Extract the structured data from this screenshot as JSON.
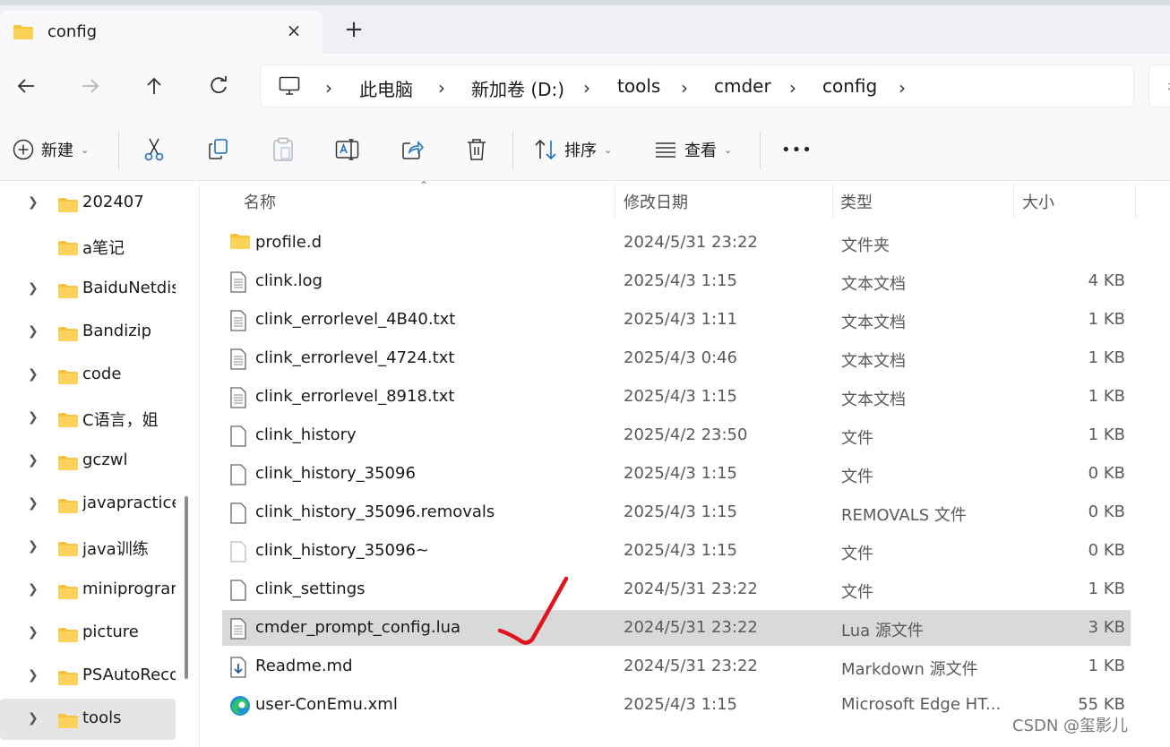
{
  "tab": {
    "title": "config",
    "close_icon": "×",
    "new_tab_icon": "+"
  },
  "breadcrumb": {
    "items": [
      "此电脑",
      "新加卷 (D:)",
      "tools",
      "cmder",
      "config"
    ],
    "separator": "›",
    "search_partial": "在"
  },
  "toolbar": {
    "new_label": "新建",
    "sort_label": "排序",
    "view_label": "查看",
    "more_label": "•••"
  },
  "sidebar": {
    "items": [
      {
        "label": "202407",
        "expandable": true
      },
      {
        "label": "a笔记",
        "expandable": false
      },
      {
        "label": "BaiduNetdisk",
        "expandable": true
      },
      {
        "label": "Bandizip",
        "expandable": true
      },
      {
        "label": "code",
        "expandable": true
      },
      {
        "label": "C语言，姐",
        "expandable": true
      },
      {
        "label": "gczwl",
        "expandable": true
      },
      {
        "label": "javapractice",
        "expandable": true
      },
      {
        "label": "java训练",
        "expandable": true
      },
      {
        "label": "miniprogram",
        "expandable": true
      },
      {
        "label": "picture",
        "expandable": true
      },
      {
        "label": "PSAutoRecover",
        "expandable": true
      },
      {
        "label": "tools",
        "expandable": true,
        "selected": true
      }
    ]
  },
  "columns": {
    "name": "名称",
    "date": "修改日期",
    "type": "类型",
    "size": "大小"
  },
  "files": [
    {
      "name": "profile.d",
      "date": "2024/5/31 23:22",
      "type": "文件夹",
      "size": "",
      "icon": "folder"
    },
    {
      "name": "clink.log",
      "date": "2025/4/3 1:15",
      "type": "文本文档",
      "size": "4 KB",
      "icon": "text"
    },
    {
      "name": "clink_errorlevel_4B40.txt",
      "date": "2025/4/3 1:11",
      "type": "文本文档",
      "size": "1 KB",
      "icon": "text"
    },
    {
      "name": "clink_errorlevel_4724.txt",
      "date": "2025/4/3 0:46",
      "type": "文本文档",
      "size": "1 KB",
      "icon": "text"
    },
    {
      "name": "clink_errorlevel_8918.txt",
      "date": "2025/4/3 1:15",
      "type": "文本文档",
      "size": "1 KB",
      "icon": "text"
    },
    {
      "name": "clink_history",
      "date": "2025/4/2 23:50",
      "type": "文件",
      "size": "1 KB",
      "icon": "file"
    },
    {
      "name": "clink_history_35096",
      "date": "2025/4/3 1:15",
      "type": "文件",
      "size": "0 KB",
      "icon": "file"
    },
    {
      "name": "clink_history_35096.removals",
      "date": "2025/4/3 1:15",
      "type": "REMOVALS 文件",
      "size": "0 KB",
      "icon": "file"
    },
    {
      "name": "clink_history_35096~",
      "date": "2025/4/3 1:15",
      "type": "文件",
      "size": "0 KB",
      "icon": "file-faded"
    },
    {
      "name": "clink_settings",
      "date": "2024/5/31 23:22",
      "type": "文件",
      "size": "1 KB",
      "icon": "file"
    },
    {
      "name": "cmder_prompt_config.lua",
      "date": "2024/5/31 23:22",
      "type": "Lua 源文件",
      "size": "3 KB",
      "icon": "text",
      "selected": true
    },
    {
      "name": "Readme.md",
      "date": "2024/5/31 23:22",
      "type": "Markdown 源文件",
      "size": "1 KB",
      "icon": "markdown"
    },
    {
      "name": "user-ConEmu.xml",
      "date": "2025/4/3 1:15",
      "type": "Microsoft Edge HT...",
      "size": "55 KB",
      "icon": "edge"
    }
  ],
  "watermark": "CSDN @玺影儿",
  "colors": {
    "folder": "#f8c43a",
    "accent_check": "#e0141e",
    "selected_row": "#d9d9d9"
  }
}
